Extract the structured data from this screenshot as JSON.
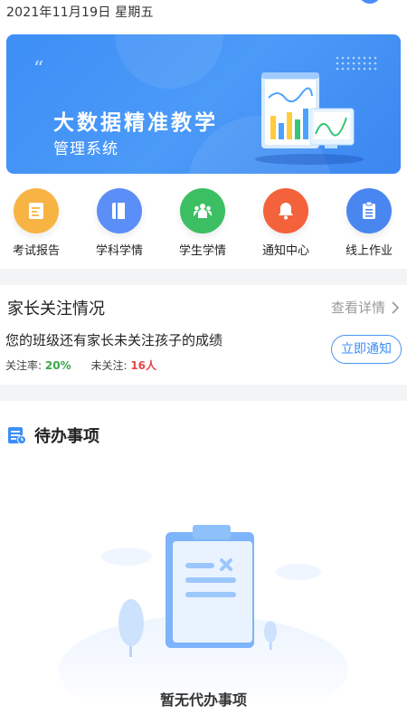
{
  "status": {
    "date": "2021年11月19日 星期五"
  },
  "banner": {
    "title": "大数据精准教学",
    "subtitle": "管理系统",
    "colors": {
      "bg": "#3d8ef6"
    }
  },
  "quick_actions": [
    {
      "label": "考试报告",
      "icon": "exam-report-icon",
      "color": "#f7b445"
    },
    {
      "label": "学科学情",
      "icon": "book-icon",
      "color": "#5b8ef7"
    },
    {
      "label": "学生学情",
      "icon": "students-icon",
      "color": "#3bbf62"
    },
    {
      "label": "通知中心",
      "icon": "bell-icon",
      "color": "#f4623c"
    },
    {
      "label": "线上作业",
      "icon": "clipboard-icon",
      "color": "#4a86f0"
    }
  ],
  "parent_attention": {
    "heading": "家长关注情况",
    "detail_link": "查看详情",
    "message": "您的班级还有家长未关注孩子的成绩",
    "rate_label": "关注率:",
    "rate_value": "20%",
    "unfollowed_label": "未关注:",
    "unfollowed_value": "16人",
    "notify_button": "立即通知"
  },
  "todo": {
    "heading": "待办事项",
    "empty_text": "暂无代办事项"
  }
}
